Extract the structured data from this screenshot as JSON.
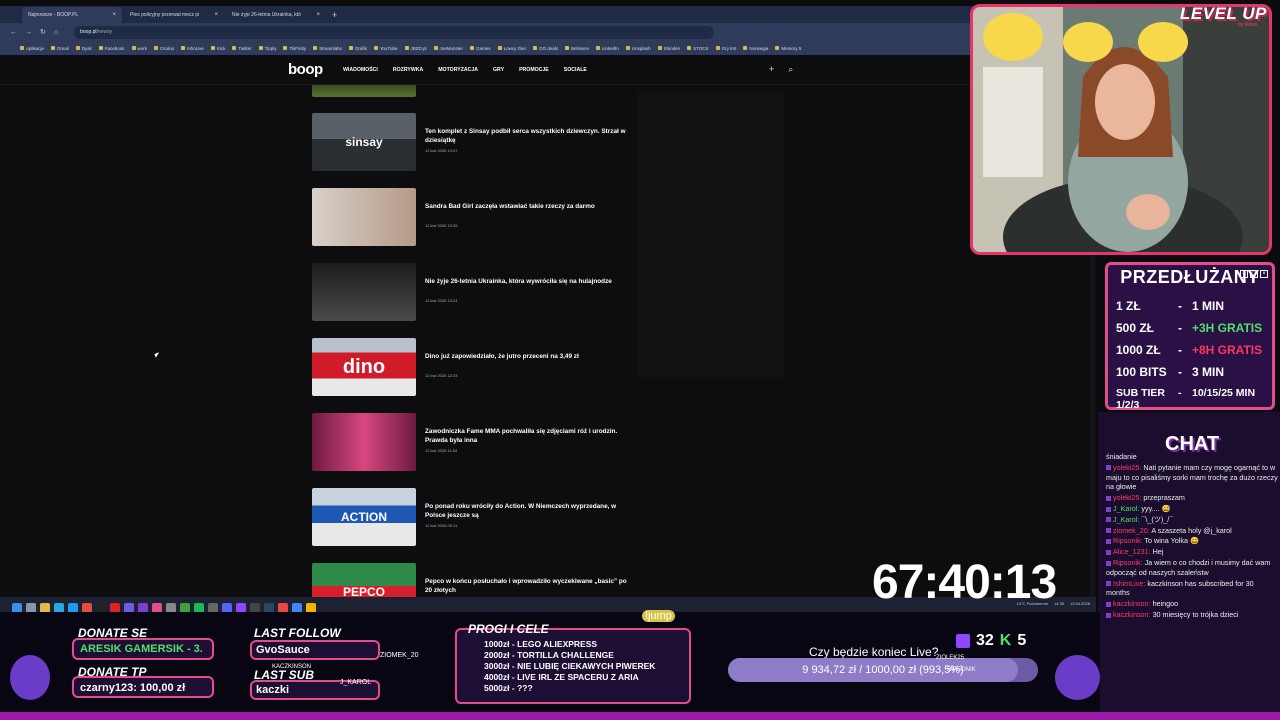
{
  "browser": {
    "tabs": [
      {
        "label": "Najnowsze - BOOP.PL",
        "active": true
      },
      {
        "label": "Pies policyjny przerwał mecz pi",
        "active": false
      },
      {
        "label": "Nie żyje 26-letnia Ukrainka, któ",
        "active": false
      }
    ],
    "url": "boop.pl",
    "url_path": "/newsy",
    "bookmarks": [
      "Aplikacje",
      "Gmail",
      "Dysk",
      "Facebook",
      "work",
      "Oculus",
      "IshoLive",
      "Kick",
      "Twitter",
      "Tipply",
      "TikFinity",
      "Streamlabs",
      "Grafik",
      "YouTube",
      "JBZD.pl",
      "JoeMonster",
      "Games",
      "Łowcy Gier",
      "GG.deals",
      "Behance",
      "LinkedIn",
      "Unsplash",
      "Shinden",
      "STOCK",
      "Gry tmt",
      "Norwegia",
      "Memory 5"
    ]
  },
  "site": {
    "logo": "boop",
    "nav": [
      "WIADOMOŚCI",
      "ROZRYWKA",
      "MOTORYZACJA",
      "GRY",
      "PROMOCJE",
      "SOCIALE"
    ],
    "plus_icon": "+",
    "search_icon": "⌕",
    "articles": [
      {
        "title": "Ten komplet z Sinsay podbił serca wszystkich dziewczyn. Strzał w dziesiątkę",
        "date": "12 kwi 2026 13:47",
        "thumb_text": "sinsay"
      },
      {
        "title": "Sandra Bad Girl zaczęła wstawiać takie rzeczy za darmo",
        "date": "12 kwi 2026 13:35",
        "thumb_text": ""
      },
      {
        "title": "Nie żyje 26-letnia Ukrainka, która wywróciła się na hulajnodze",
        "date": "12 kwi 2026 13:24",
        "thumb_text": ""
      },
      {
        "title": "Dino już zapowiedziało, że jutro przeceni na 3,49 zł",
        "date": "12 kwi 2026 12:23",
        "thumb_text": "dino"
      },
      {
        "title": "Zawodniczka Fame MMA pochwaliła się zdjęciami róż i urodzin. Prawda była inna",
        "date": "12 kwi 2026 11:54",
        "thumb_text": ""
      },
      {
        "title": "Po ponad roku wróciły do Action. W Niemczech wyprzedane, w Polsce jeszcze są",
        "date": "12 kwi 2026 09:11",
        "thumb_text": "ACTION"
      },
      {
        "title": "Pepco w końcu posłuchało i wprowadziło wyczekiwane „basic” po 20 złotych",
        "date": "",
        "thumb_text": "PEPCO"
      }
    ]
  },
  "taskbar": {
    "weather": "14°C Pochmurnie",
    "time": "14:35",
    "date": "12.04.2026"
  },
  "stream": {
    "brand": "LEVEL UP",
    "brand_sub": "by Roxie",
    "price_panel": {
      "title": "PRZEDŁUŻANY",
      "rows": [
        {
          "amount": "1 ZŁ",
          "value": "1 MIN",
          "color": "white"
        },
        {
          "amount": "500 ZŁ",
          "value": "+3H GRATIS",
          "color": "green"
        },
        {
          "amount": "1000 ZŁ",
          "value": "+8H GRATIS",
          "color": "red"
        },
        {
          "amount": "100 BITS",
          "value": "3 MIN",
          "color": "white"
        },
        {
          "amount": "SUB TIER 1/2/3",
          "value": "10/15/25 MIN",
          "color": "white"
        }
      ]
    },
    "chat_title": "CHAT",
    "chat": [
      {
        "user": "",
        "text": "śniadanie",
        "ucolor": "ub"
      },
      {
        "user": "yoleki25:",
        "text": "Nati pytanie mam czy mogę ogarnąć to w maju to co pisaliśmy sorki mam trochę za dużo rzeczy na głowie",
        "ucolor": "u"
      },
      {
        "user": "yoleki25:",
        "text": "przepraszam",
        "ucolor": "u"
      },
      {
        "user": "J_Karol:",
        "text": "yyy.... 😅",
        "ucolor": "ug"
      },
      {
        "user": "J_Karol:",
        "text": "¯\\_(ツ)_/¯",
        "ucolor": "ug"
      },
      {
        "user": "ziomek_20:",
        "text": "A szaszeta holy @j_karol",
        "ucolor": "u"
      },
      {
        "user": "Ripsonik:",
        "text": "To wina Yolka 😄",
        "ucolor": "u"
      },
      {
        "user": "Alice_1231:",
        "text": "Hej",
        "ucolor": "u"
      },
      {
        "user": "Ripsonik:",
        "text": "Ja wiem o co chodzi i musimy dać wam odpocząć od naszych szaleństw",
        "ucolor": "u"
      },
      {
        "user": "IshimLive:",
        "text": "kaczkinson has subscribed for 30 months",
        "ucolor": "u"
      },
      {
        "user": "kaczkinson:",
        "text": "heingoo",
        "ucolor": "u"
      },
      {
        "user": "kaczkinson:",
        "text": "30 miesięcy to trójka dzieci",
        "ucolor": "u"
      }
    ],
    "timer": "67:40:13",
    "donate_se": {
      "title": "DONATE SE",
      "value": "ARESIK GAMERSIK - 3."
    },
    "donate_tp": {
      "title": "DONATE TP",
      "value": "czarny123: 100,00 zł"
    },
    "last_follow": {
      "title": "LAST FOLLOW",
      "value": "GvoSauce"
    },
    "last_sub": {
      "title": "LAST SUB",
      "value": "kaczki"
    },
    "game_names": [
      "KACZKINSON",
      "ZIOMEK_20",
      "J_KAROL"
    ],
    "goals": {
      "title": "PROGI I CELE",
      "items": [
        "1000zł - LEGO ALIEXPRESS",
        "2000zł - TORTILLA CHALLENGE",
        "3000zł - NIE LUBIĘ CIEKAWYCH PIWEREK",
        "4000zł - LIVE IRL ZE SPACERU Z ARIA",
        "5000zł - ???"
      ]
    },
    "jump_label": "!jump",
    "goal_question": "Czy będzie koniec Live?",
    "goal_progress_text": "9 934,72 zł / 1000,00 zł (993,5%)",
    "goal_progress": 0.935,
    "viewers": "32",
    "kick_count": "5",
    "game_tags": [
      "ZIOLEK25",
      "RIPSONIK"
    ]
  },
  "colors": {
    "accent": "#e34d8b",
    "panel": "#2a1044",
    "green": "#52e06a",
    "red": "#ff3565"
  }
}
